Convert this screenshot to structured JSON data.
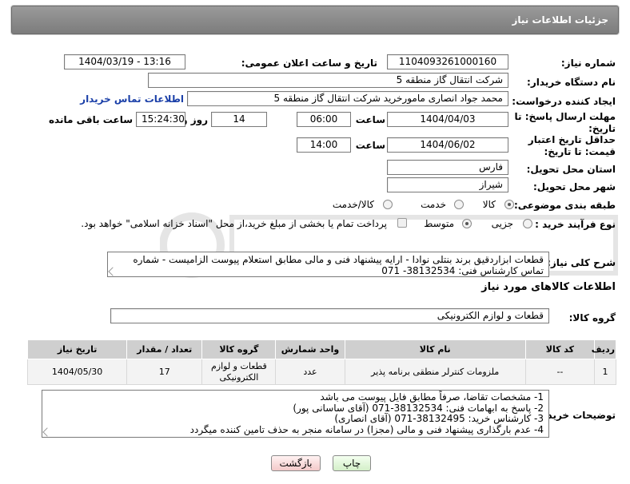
{
  "header": {
    "title": "جزئیات اطلاعات نیاز"
  },
  "labels": {
    "need_number": "شماره نیاز:",
    "announce_datetime": "تاریخ و ساعت اعلان عمومی:",
    "buyer_org": "نام دستگاه خریدار:",
    "requester": "ایجاد کننده درخواست:",
    "buyer_contact_link": "اطلاعات تماس خریدار",
    "reply_deadline": "مهلت ارسال پاسخ: تا تاریخ:",
    "hour": "ساعت",
    "days_and": "روز و",
    "hours_remaining": "ساعت باقی مانده",
    "price_validity": "حداقل تاریخ اعتبار قیمت: تا تاریخ:",
    "hour2": "ساعت",
    "delivery_province": "استان محل تحویل:",
    "delivery_city": "شهر محل تحویل:",
    "category": "طبقه بندی موضوعی:",
    "process_type": "نوع فرآیند خرید :",
    "description": "شرح کلی نیاز:",
    "goods_info": "اطلاعات کالاهای مورد نیاز",
    "goods_group": "گروه کالا:",
    "buyer_notes": "توضیحات خریدار:"
  },
  "fields": {
    "need_number": "1104093261000160",
    "announce_datetime": "1404/03/19 - 13:16",
    "buyer_org": "شرکت انتقال گاز منطقه 5",
    "requester": "محمد جواد انصاری مامورخرید شرکت انتقال گاز منطقه 5",
    "reply_date": "1404/04/03",
    "reply_time": "06:00",
    "days": "14",
    "remaining_time": "15:24:30",
    "validity_date": "1404/06/02",
    "validity_time": "14:00",
    "province": "فارس",
    "city": "شیراز",
    "description": "قطعات ابزاردقیق برند بنتلی نوادا - ارایه پیشنهاد فنی و مالی مطابق استعلام پیوست الزامیست - شماره تماس کارشناس فنی: 38132534- 071",
    "goods_group": "قطعات و لوازم الکترونیکی"
  },
  "category_options": [
    {
      "label": "کالا",
      "selected": true
    },
    {
      "label": "خدمت",
      "selected": false
    },
    {
      "label": "کالا/خدمت",
      "selected": false
    }
  ],
  "process_options": [
    {
      "label": "جزیی",
      "selected": false
    },
    {
      "label": "متوسط",
      "selected": true
    }
  ],
  "process_note": "پرداخت تمام یا بخشی از مبلغ خرید،از محل \"اسناد خزانه اسلامی\" خواهد بود.",
  "table": {
    "headers": [
      "ردیف",
      "کد کالا",
      "نام کالا",
      "واحد شمارش",
      "گروه کالا",
      "تعداد / مقدار",
      "تاریخ نیاز"
    ],
    "rows": [
      [
        "1",
        "--",
        "ملزومات کنترلر منطقی برنامه پذیر",
        "عدد",
        "قطعات و لوازم الکترونیکی",
        "17",
        "1404/05/30"
      ]
    ]
  },
  "buyer_notes": [
    "1-  مشخصات تقاضا، صرفاً مطابق فایل پیوست می باشد",
    "2- پاسخ به ابهامات فنی: 38132534-071 (آقای ساسانی پور)",
    "3- کارشناس خرید: 38132495-071 (آقای انصاری)",
    "4- عدم بارگذاری پیشنهاد فنی و مالی (مجزا) در سامانه منجر به حذف تامین کننده میگردد"
  ],
  "buttons": {
    "print": "چاپ",
    "back": "بازگشت"
  },
  "colors": {
    "header": "#8a8a8a",
    "link": "#1a3fa8",
    "back_button": "#f9d6d6",
    "print_button": "#dff5d8"
  }
}
